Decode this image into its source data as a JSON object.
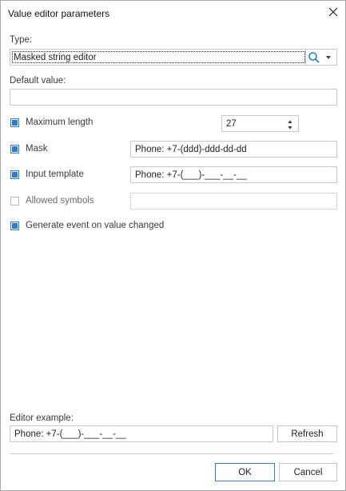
{
  "dialog": {
    "title": "Value editor parameters"
  },
  "type": {
    "label": "Type:",
    "value": "Masked string editor"
  },
  "default_value": {
    "label": "Default value:",
    "value": ""
  },
  "maximum_length": {
    "label": "Maximum length",
    "checked": true,
    "value": "27"
  },
  "mask": {
    "label": "Mask",
    "checked": true,
    "value": "Phone: +7-(ddd)-ddd-dd-dd"
  },
  "input_template": {
    "label": "Input template",
    "checked": true,
    "value": "Phone: +7-(___)-___-__-__"
  },
  "allowed_symbols": {
    "label": "Allowed symbols",
    "checked": false,
    "value": ""
  },
  "generate_event": {
    "label": "Generate event on value changed",
    "checked": true
  },
  "editor_example": {
    "label": "Editor example:",
    "value": "Phone: +7-(___)-___-__-__",
    "refresh_label": "Refresh"
  },
  "buttons": {
    "ok": "OK",
    "cancel": "Cancel"
  },
  "colors": {
    "accent": "#2b7cd3",
    "border": "#c8c8c8"
  },
  "icons": {
    "close": "close-icon",
    "search": "search-icon",
    "dropdown": "chevron-down-icon",
    "spin_up": "spin-up-icon",
    "spin_down": "spin-down-icon"
  }
}
